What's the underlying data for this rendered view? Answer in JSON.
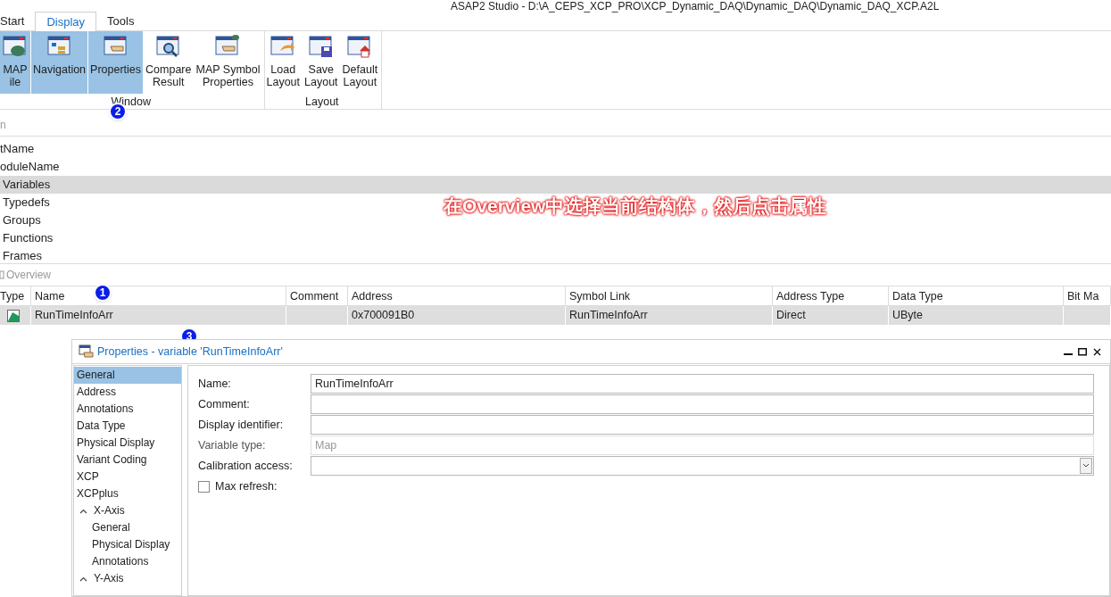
{
  "window": {
    "title": "ASAP2 Studio - D:\\A_CEPS_XCP_PRO\\XCP_Dynamic_DAQ\\Dynamic_DAQ\\Dynamic_DAQ_XCP.A2L"
  },
  "ribbon_tabs": [
    {
      "label": "Start",
      "selected": false
    },
    {
      "label": "Display",
      "selected": true
    },
    {
      "label": "Tools",
      "selected": false
    }
  ],
  "ribbon_groups": [
    {
      "label": "Window",
      "buttons": [
        {
          "lines": [
            "MAP",
            "ile"
          ],
          "selected": true
        },
        {
          "lines": [
            "Navigation"
          ],
          "selected": true
        },
        {
          "lines": [
            "Properties"
          ],
          "selected": true
        },
        {
          "lines": [
            "Compare",
            "Result"
          ],
          "selected": false
        },
        {
          "lines": [
            "MAP Symbol",
            "Properties"
          ],
          "selected": false
        }
      ]
    },
    {
      "label": "Layout",
      "buttons": [
        {
          "lines": [
            "Load",
            "Layout"
          ],
          "selected": false
        },
        {
          "lines": [
            "Save",
            "Layout"
          ],
          "selected": false
        },
        {
          "lines": [
            "Default",
            "Layout"
          ],
          "selected": false
        }
      ]
    }
  ],
  "navigation": {
    "title": "n",
    "items": [
      {
        "label": "tName",
        "selected": false
      },
      {
        "label": "oduleName",
        "selected": false
      },
      {
        "label": "Variables",
        "selected": true
      },
      {
        "label": "Typedefs",
        "selected": false
      },
      {
        "label": "Groups",
        "selected": false
      },
      {
        "label": "Functions",
        "selected": false
      },
      {
        "label": "Frames",
        "selected": false
      }
    ]
  },
  "annotation": "在Overview中选择当前结构体，然后点击属性",
  "badges": [
    "1",
    "2",
    "3"
  ],
  "overview": {
    "title": "Overview",
    "columns": [
      "Type",
      "Name",
      "Comment",
      "Address",
      "Symbol Link",
      "Address Type",
      "Data Type",
      "Bit Ma"
    ],
    "rows": [
      {
        "selected": true,
        "cells": [
          "",
          "RunTimeInfoArr",
          "",
          "0x700091B0",
          "RunTimeInfoArr",
          "Direct",
          "UByte",
          ""
        ]
      }
    ]
  },
  "properties": {
    "title": "Properties - variable 'RunTimeInfoArr'",
    "pages": [
      {
        "label": "General",
        "selected": true
      },
      {
        "label": "Address",
        "selected": false
      },
      {
        "label": "Annotations",
        "selected": false
      },
      {
        "label": "Data Type",
        "selected": false
      },
      {
        "label": "Physical Display",
        "selected": false
      },
      {
        "label": "Variant Coding",
        "selected": false
      },
      {
        "label": "XCP",
        "selected": false
      },
      {
        "label": "XCPplus",
        "selected": false
      },
      {
        "label": "X-Axis",
        "selected": false,
        "expanded": true,
        "children": [
          {
            "label": "General",
            "selected": false
          },
          {
            "label": "Physical Display",
            "selected": false
          },
          {
            "label": "Annotations",
            "selected": false
          }
        ]
      },
      {
        "label": "Y-Axis",
        "selected": false,
        "expanded": true
      }
    ],
    "fields": [
      {
        "kind": "text",
        "label": "Name:",
        "value": "RunTimeInfoArr",
        "disabled": false
      },
      {
        "kind": "text",
        "label": "Comment:",
        "disabled": false
      },
      {
        "kind": "text",
        "label": "Display identifier:",
        "disabled": false
      },
      {
        "kind": "text",
        "label": "Variable type:",
        "value": "Map",
        "disabled": true
      },
      {
        "kind": "dropdown",
        "label": "Calibration access:",
        "disabled": false
      },
      {
        "kind": "checkbox",
        "label": "Max refresh:",
        "checked": false
      }
    ]
  }
}
